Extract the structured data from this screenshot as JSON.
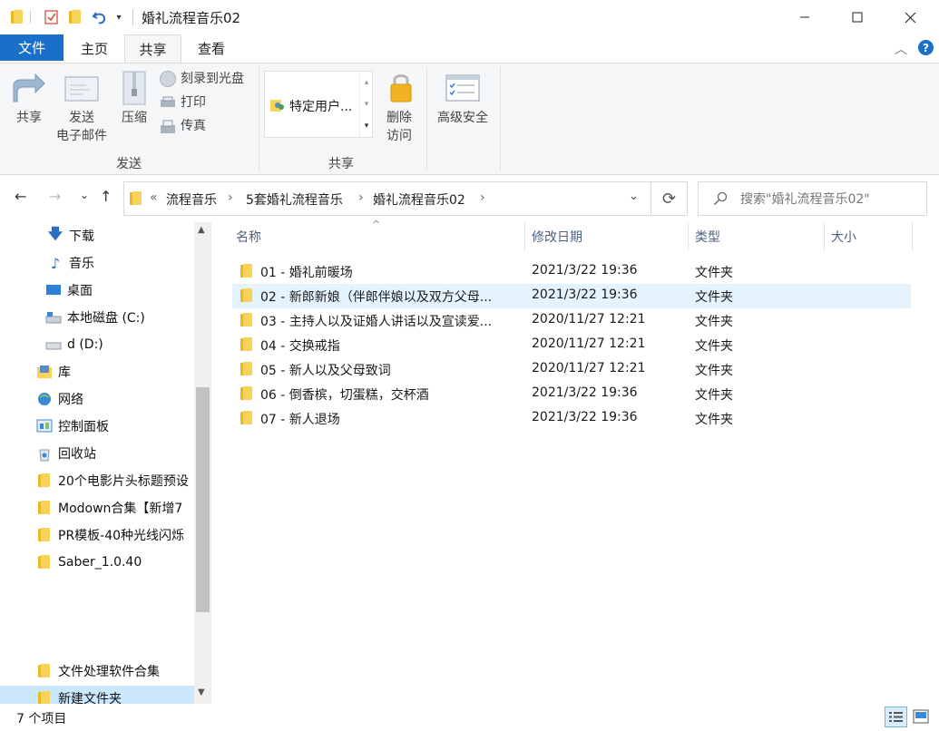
{
  "window": {
    "title": "婚礼流程音乐02",
    "controls": [
      "minimize-icon",
      "maximize-icon",
      "close-icon"
    ]
  },
  "tabs": {
    "file": "文件",
    "home": "主页",
    "share": "共享",
    "view": "查看"
  },
  "ribbon": {
    "share_btn": "共享",
    "email_btn_line1": "发送",
    "email_btn_line2": "电子邮件",
    "zip_btn": "压缩",
    "burn_btn": "刻录到光盘",
    "print_btn": "打印",
    "fax_btn": "传真",
    "send_group": "发送",
    "share_with": "特定用户...",
    "remove_access_line1": "删除",
    "remove_access_line2": "访问",
    "advanced_security": "高级安全",
    "share_group": "共享"
  },
  "address": {
    "overflow": "«",
    "crumbs": [
      "流程音乐",
      "5套婚礼流程音乐",
      "婚礼流程音乐02"
    ],
    "search_placeholder": "搜索\"婚礼流程音乐02\""
  },
  "sidebar": {
    "items": [
      {
        "label": "下载",
        "icon": "download-arrow-icon"
      },
      {
        "label": "音乐",
        "icon": "music-note-icon"
      },
      {
        "label": "桌面",
        "icon": "desktop-icon"
      },
      {
        "label": "本地磁盘 (C:)",
        "icon": "drive-icon"
      },
      {
        "label": "d (D:)",
        "icon": "drive-icon"
      },
      {
        "label": "库",
        "icon": "library-icon"
      },
      {
        "label": "网络",
        "icon": "network-icon"
      },
      {
        "label": "控制面板",
        "icon": "control-panel-icon"
      },
      {
        "label": "回收站",
        "icon": "recycle-bin-icon"
      },
      {
        "label": "20个电影片头标题预设",
        "icon": "folder-icon"
      },
      {
        "label": "Modown合集【新增7",
        "icon": "folder-icon"
      },
      {
        "label": "PR模板-40种光线闪烁",
        "icon": "folder-icon"
      },
      {
        "label": "Saber_1.0.40",
        "icon": "folder-icon"
      },
      {
        "label": "文件处理软件合集",
        "icon": "folder-icon"
      },
      {
        "label": "新建文件夹",
        "icon": "folder-icon"
      }
    ]
  },
  "columns": {
    "name": "名称",
    "date": "修改日期",
    "type": "类型",
    "size": "大小"
  },
  "files": [
    {
      "name": "01 - 婚礼前暖场",
      "date": "2021/3/22 19:36",
      "type": "文件夹"
    },
    {
      "name": "02 - 新郎新娘（伴郎伴娘以及双方父母...",
      "date": "2021/3/22 19:36",
      "type": "文件夹"
    },
    {
      "name": "03 - 主持人以及证婚人讲话以及宣读爱...",
      "date": "2020/11/27 12:21",
      "type": "文件夹"
    },
    {
      "name": "04 - 交换戒指",
      "date": "2020/11/27 12:21",
      "type": "文件夹"
    },
    {
      "name": "05 - 新人以及父母致词",
      "date": "2020/11/27 12:21",
      "type": "文件夹"
    },
    {
      "name": "06 - 倒香槟，切蛋糕，交杯酒",
      "date": "2021/3/22 19:36",
      "type": "文件夹"
    },
    {
      "name": "07 - 新人退场",
      "date": "2021/3/22 19:36",
      "type": "文件夹"
    }
  ],
  "status": {
    "count": "7 个项目"
  },
  "colors": {
    "accent": "#1a6fc9",
    "hover_row": "#e5f3ff",
    "selected": "#cce8ff",
    "folder": "#f8d35a"
  }
}
